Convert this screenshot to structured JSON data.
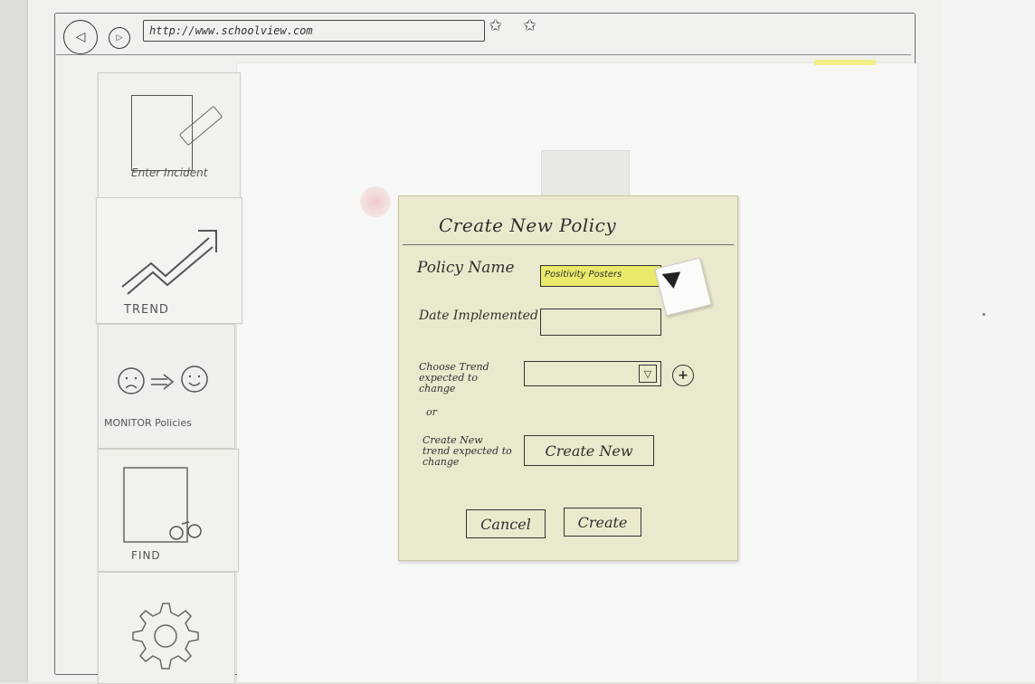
{
  "browser": {
    "url": "http://www.schoolview.com",
    "back_symbol": "◁",
    "forward_symbol": "▷",
    "star_symbol": "✩"
  },
  "sidebar": {
    "items": [
      {
        "label": "Enter Incident",
        "icon": "document-pencil-icon"
      },
      {
        "label": "TREND",
        "icon": "trend-arrow-icon"
      },
      {
        "label": "MONITOR Policies",
        "icon": "sad-to-happy-face-icon"
      },
      {
        "label": "FIND",
        "icon": "binoculars-document-icon"
      },
      {
        "label": "",
        "icon": "gear-icon"
      }
    ]
  },
  "dialog": {
    "title": "Create New Policy",
    "policy_name_label": "Policy Name",
    "policy_name_value": "Positivity Posters",
    "date_label": "Date Implemented",
    "date_value": "",
    "trend_label": "Choose Trend expected to change",
    "trend_value": "",
    "add_symbol": "+",
    "dropdown_symbol": "▽",
    "or_label": "or",
    "create_trend_label": "Create New trend expected to change",
    "create_new_button": "Create New",
    "cancel_button": "Cancel",
    "create_button": "Create"
  },
  "colors": {
    "dialog_background": "#ebe9cd",
    "highlight": "#e9ea6a"
  }
}
